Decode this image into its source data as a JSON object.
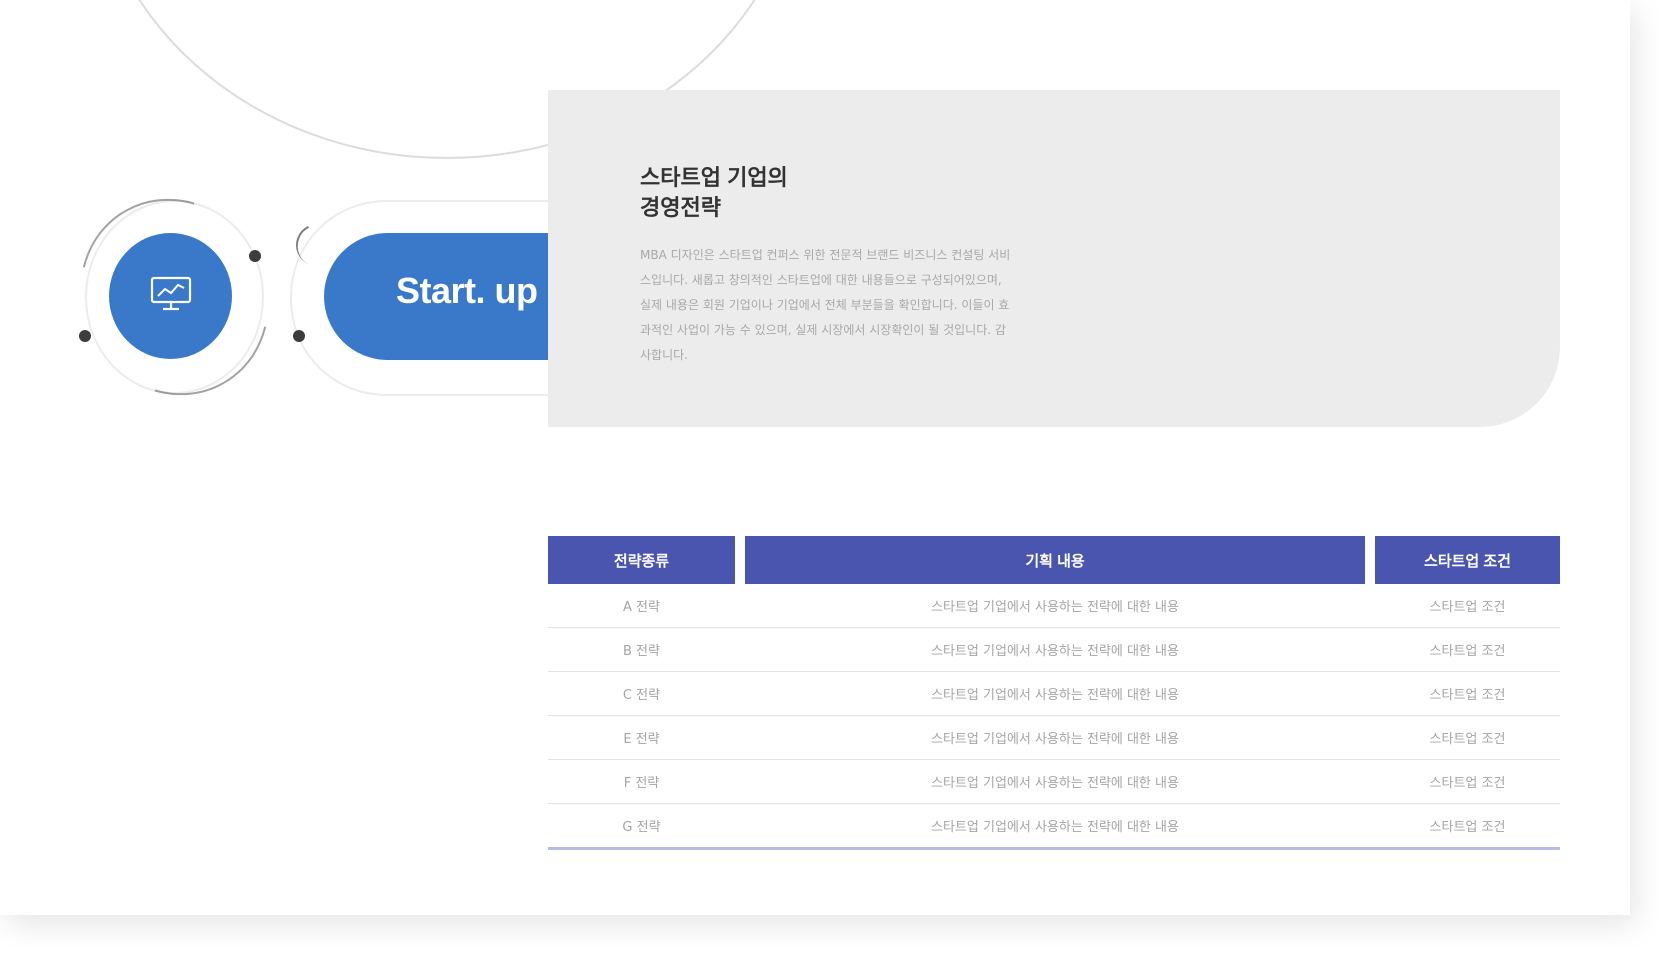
{
  "brand_color": "#3a79c9",
  "table_header_color": "#4a55b0",
  "hero": {
    "icon": "monitor-chart-icon",
    "pill_label": "Start. up"
  },
  "card": {
    "title_line1": "스타트업 기업의",
    "title_line2": "경영전략",
    "body": "MBA 디자인은 스타트업 컨퍼스 위한 전문적 브랜드 비즈니스 컨설팅 서비스입니다. 새롭고 창의적인 스타트업에 대한 내용들으로 구성되어있으며, 실제 내용은 회원 기업이나 기업에서 전체 부분들을 확인합니다. 이들이 효과적인 사업이 가능 수 있으며, 실제 시장에서 시장확인이 될 것입니다. 감사합니다."
  },
  "table": {
    "headers": [
      "전략종류",
      "기획 내용",
      "스타트업 조건"
    ],
    "rows": [
      [
        "A 전략",
        "스타트업 기업에서 사용하는 전략에 대한 내용",
        "스타트업 조건"
      ],
      [
        "B 전략",
        "스타트업 기업에서 사용하는 전략에 대한 내용",
        "스타트업 조건"
      ],
      [
        "C 전략",
        "스타트업 기업에서 사용하는 전략에 대한 내용",
        "스타트업 조건"
      ],
      [
        "E 전략",
        "스타트업 기업에서 사용하는 전략에 대한 내용",
        "스타트업 조건"
      ],
      [
        "F 전략",
        "스타트업 기업에서 사용하는 전략에 대한 내용",
        "스타트업 조건"
      ],
      [
        "G 전략",
        "스타트업 기업에서 사용하는 전략에 대한 내용",
        "스타트업 조건"
      ]
    ]
  }
}
